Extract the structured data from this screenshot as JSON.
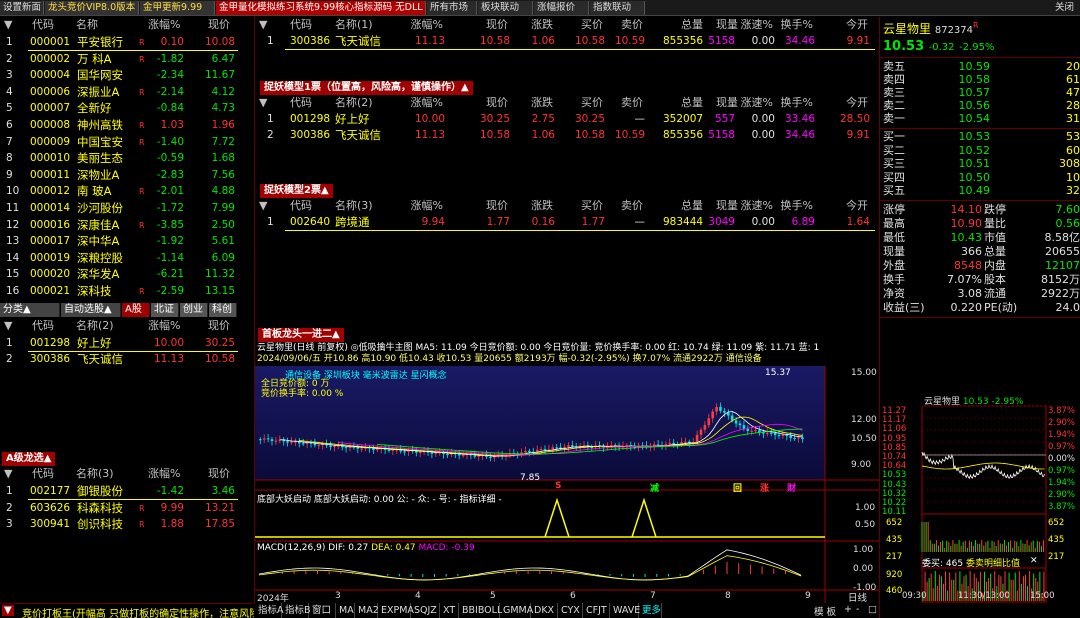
{
  "tabs": [
    {
      "label": "设置新面",
      "style": ""
    },
    {
      "label": "龙头竞价VIP8.0版本",
      "style": "hl"
    },
    {
      "label": "金甲更新9.99",
      "style": "hl"
    },
    {
      "label": "金甲量化模拟练习系统9.99核心指标源码 无DLL",
      "style": "red"
    },
    {
      "label": "所有市场",
      "style": ""
    },
    {
      "label": "板块联动",
      "style": ""
    },
    {
      "label": "涨幅报价",
      "style": ""
    },
    {
      "label": "指数联动",
      "style": ""
    }
  ],
  "close_label": "关闭",
  "main_list": {
    "headers": [
      "代码",
      "名称",
      "涨幅%",
      "现价"
    ],
    "rows": [
      [
        "1",
        "000001",
        "平安银行",
        "R",
        "0.10",
        "10.08",
        "red"
      ],
      [
        "2",
        "000002",
        "万 科A",
        "R",
        "-1.82",
        "6.47",
        "grn"
      ],
      [
        "3",
        "000004",
        "国华网安",
        "",
        "-2.34",
        "11.67",
        "grn"
      ],
      [
        "4",
        "000006",
        "深振业A",
        "R",
        "-2.14",
        "4.12",
        "grn"
      ],
      [
        "5",
        "000007",
        "全新好",
        "",
        "-0.84",
        "4.73",
        "grn"
      ],
      [
        "6",
        "000008",
        "神州高铁",
        "R",
        "1.03",
        "1.96",
        "red"
      ],
      [
        "7",
        "000009",
        "中国宝安",
        "R",
        "-1.40",
        "7.72",
        "grn"
      ],
      [
        "8",
        "000010",
        "美丽生态",
        "",
        "-0.59",
        "1.68",
        "grn"
      ],
      [
        "9",
        "000011",
        "深物业A",
        "",
        "-2.83",
        "7.56",
        "grn"
      ],
      [
        "10",
        "000012",
        "南 玻A",
        "R",
        "-2.01",
        "4.88",
        "grn"
      ],
      [
        "11",
        "000014",
        "沙河股份",
        "",
        "-1.72",
        "7.99",
        "grn"
      ],
      [
        "12",
        "000016",
        "深康佳A",
        "R",
        "-3.85",
        "2.50",
        "grn"
      ],
      [
        "13",
        "000017",
        "深中华A",
        "",
        "-1.92",
        "5.61",
        "grn"
      ],
      [
        "14",
        "000019",
        "深粮控股",
        "",
        "-1.14",
        "6.09",
        "grn"
      ],
      [
        "15",
        "000020",
        "深华发A",
        "",
        "-6.21",
        "11.32",
        "grn"
      ],
      [
        "16",
        "000021",
        "深科技",
        "R",
        "-2.59",
        "13.15",
        "grn"
      ]
    ]
  },
  "sub_tabs": [
    "分类▲",
    "自动选股▲",
    "A股",
    "北证",
    "创业",
    "科创"
  ],
  "list2": {
    "headers": [
      "代码",
      "名称(2)",
      "涨幅%",
      "现价"
    ],
    "rows": [
      [
        "1",
        "001298",
        "好上好",
        "10.00",
        "30.25"
      ],
      [
        "2",
        "300386",
        "飞天诚信",
        "11.13",
        "10.58"
      ]
    ]
  },
  "section_a": "A级龙选▲",
  "list3": {
    "headers": [
      "代码",
      "名称(3)",
      "涨幅%",
      "现价"
    ],
    "rows": [
      [
        "1",
        "002177",
        "御银股份",
        "-1.42",
        "3.46",
        "grn"
      ],
      [
        "2",
        "603626",
        "科森科技",
        "R",
        "9.99",
        "13.21",
        "red"
      ],
      [
        "3",
        "300941",
        "创识科技",
        "R",
        "1.88",
        "17.85",
        "red"
      ]
    ]
  },
  "bottom_status": "竞价打板王(开幅高 只做打板的确定性操作，注意风险",
  "mid_headers": [
    "代码",
    "名称(1)",
    "涨幅%",
    "现价",
    "涨跌",
    "买价",
    "卖价",
    "总量",
    "现量",
    "涨速%",
    "换手%",
    "今开"
  ],
  "mid_top": [
    [
      "1",
      "300386",
      "飞天诚信",
      "11.13",
      "10.58",
      "1.06",
      "10.58",
      "10.59",
      "855356",
      "5158",
      "0.00",
      "34.46",
      "9.91"
    ]
  ],
  "model1_title": "捉妖模型1票（位置高，风险高，谨慎操作）▲",
  "model1_headers": [
    "代码",
    "名称(2)",
    "涨幅%",
    "现价",
    "涨跌",
    "买价",
    "卖价",
    "总量",
    "现量",
    "涨速%",
    "换手%",
    "今开"
  ],
  "model1_rows": [
    [
      "1",
      "001298",
      "好上好",
      "10.00",
      "30.25",
      "2.75",
      "30.25",
      "—",
      "352007",
      "557",
      "0.00",
      "33.46",
      "28.50"
    ],
    [
      "2",
      "300386",
      "飞天诚信",
      "11.13",
      "10.58",
      "1.06",
      "10.58",
      "10.59",
      "855356",
      "5158",
      "0.00",
      "34.46",
      "9.91"
    ]
  ],
  "model2_title": "捉妖模型2票▲",
  "model2_headers": [
    "代码",
    "名称(3)",
    "涨幅%",
    "现价",
    "涨跌",
    "买价",
    "卖价",
    "总量",
    "现量",
    "涨速%",
    "换手%",
    "今开"
  ],
  "model2_rows": [
    [
      "1",
      "002640",
      "跨境通",
      "9.94",
      "1.77",
      "0.16",
      "1.77",
      "—",
      "983444",
      "3049",
      "0.00",
      "6.89",
      "1.64"
    ]
  ],
  "chart_section_title": "首板龙头一进二▲",
  "chart_title_line": "云星物里(日线 前复权) ◎低吸擒牛主图 MA5: 11.09 今日竞价额: 0.00 今日竞价量: 竞价换手率: 0.00 红: 10.74 绿: 11.09 紫: 11.71 蓝: 1",
  "chart_info_line": "2024/09/06/五 开10.86 高10.90 低10.43 收10.53 量20655 额2193万 幅-0.32(-2.95%) 换7.07% 流通2922万 通信设备",
  "chart_cyan_line": "通信设备 深圳板块 毫米波雷达 星闪概念",
  "chart_yellow_1": "全日竞价额: 0 万",
  "chart_yellow_2": "竞价换手率: 0.00 %",
  "chart_peak_label": "15.37",
  "chart_low_label": "7.85",
  "chart_y_ticks": [
    "15.00",
    "12.00",
    "10.50",
    "9.00"
  ],
  "chart_markers": [
    {
      "t": "S",
      "c": "#ff3232"
    },
    {
      "t": "减",
      "c": "#00ff00"
    },
    {
      "t": "回",
      "c": "#ffff00"
    },
    {
      "t": "涨",
      "c": "#ff3232"
    },
    {
      "t": "财",
      "c": "#ff00ff"
    }
  ],
  "ind1_title": "底部大妖启动  底部大妖启动: 0.00  公: -  众: -  号: -  指标详细 -",
  "ind1_ticks": [
    "1.00",
    "0.50"
  ],
  "ind2_title_pre": "MACD(12,26,9)",
  "ind2_dif": "DIF: 0.27",
  "ind2_dea": "DEA: 0.47",
  "ind2_macd": "MACD: -0.39",
  "ind2_ticks": [
    "1.00",
    "0.00",
    "-1.00"
  ],
  "chart_x_labels": [
    "2024年",
    "3",
    "4",
    "5",
    "6",
    "7",
    "8",
    "9"
  ],
  "bottom_tabs": [
    "指标A",
    "指标B",
    "窗口",
    "MA",
    "MA2",
    "EXPMA",
    "SQJZ",
    "XT",
    "BBIBOLL",
    "GMMA",
    "DKX",
    "CYX",
    "CFJT",
    "WAVE",
    "更多"
  ],
  "bottom_right": [
    "模 板",
    "日线",
    "+",
    "-",
    "□"
  ],
  "quote": {
    "name": "云星物里",
    "code": "872374",
    "r": "R",
    "price": "10.53",
    "chg": "-0.32",
    "pct": "-2.95%",
    "sells": [
      [
        "卖五",
        "10.59",
        "20"
      ],
      [
        "卖四",
        "10.58",
        "61"
      ],
      [
        "卖三",
        "10.57",
        "47"
      ],
      [
        "卖二",
        "10.56",
        "28"
      ],
      [
        "卖一",
        "10.54",
        "31"
      ]
    ],
    "buys": [
      [
        "买一",
        "10.53",
        "53"
      ],
      [
        "买二",
        "10.52",
        "60"
      ],
      [
        "买三",
        "10.51",
        "308"
      ],
      [
        "买四",
        "10.50",
        "10"
      ],
      [
        "买五",
        "10.49",
        "32"
      ]
    ],
    "stats": [
      [
        "涨停",
        "14.10",
        "red",
        "跌停",
        "7.60",
        "grn"
      ],
      [
        "最高",
        "10.90",
        "red",
        "量比",
        "0.56",
        "grn"
      ],
      [
        "最低",
        "10.43",
        "grn",
        "市值",
        "8.58亿",
        "wht"
      ],
      [
        "现量",
        "366",
        "wht",
        "总量",
        "20655",
        "wht"
      ],
      [
        "外盘",
        "8548",
        "red",
        "内盘",
        "12107",
        "grn"
      ],
      [
        "换手",
        "7.07%",
        "wht",
        "股本",
        "8152万",
        "wht"
      ],
      [
        "净资",
        "3.08",
        "wht",
        "流通",
        "2922万",
        "wht"
      ],
      [
        "收益(三)",
        "0.220",
        "wht",
        "PE(动)",
        "24.0",
        "wht"
      ]
    ],
    "mini_title": "云星物里",
    "mini_price": "10.53",
    "mini_pct": "-2.95%",
    "mini_left": [
      "11.27",
      "11.17",
      "11.06",
      "10.95",
      "10.85",
      "10.74",
      "10.64",
      "10.53",
      "10.43",
      "10.32",
      "10.22",
      "10.11"
    ],
    "mini_right": [
      "3.87%",
      "2.90%",
      "1.94%",
      "0.97%",
      "0.00%",
      "0.97%",
      "1.94%",
      "2.90%",
      "3.87%"
    ],
    "mini_vol": [
      "652",
      "435",
      "217"
    ],
    "mini_vol_r": [
      "652",
      "435",
      "217"
    ],
    "auction_label": "委买: 465",
    "auction_label2": "委卖明细比值",
    "auction_ticks": [
      "920",
      "460"
    ],
    "mini_times": [
      "09:30",
      "11:30/13:00",
      "15:00"
    ]
  }
}
